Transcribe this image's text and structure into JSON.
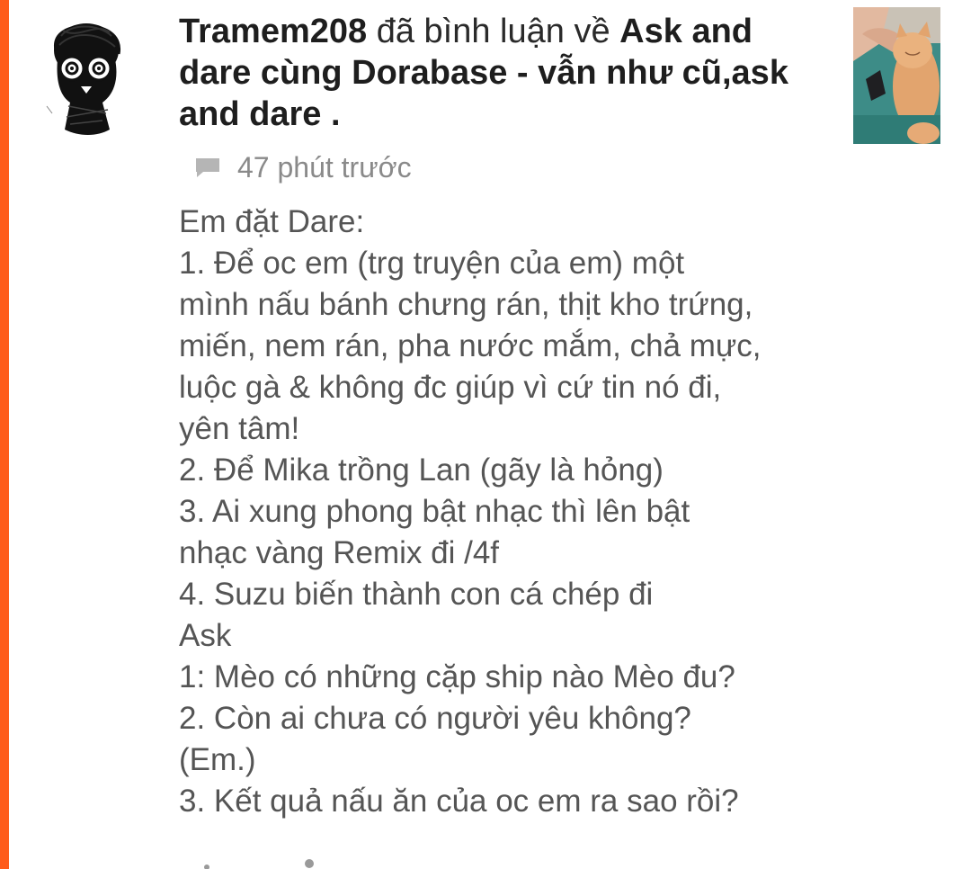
{
  "notification": {
    "username": "Tramem208",
    "verb": "đã bình luận về",
    "post_title_line1": "Ask and",
    "post_title_line2": "dare cùng Dorabase - vẫn như cũ,ask",
    "post_title_line3": "and dare .",
    "time_ago": "47 phút trước",
    "comment_lines": [
      "Em đặt Dare:",
      "1. Để oc em (trg truyện của em) một",
      "mình nấu bánh chưng rán, thịt kho trứng,",
      "miến, nem rán, pha nước mắm, chả mực,",
      "luộc gà & không đc giúp vì cứ tin nó đi,",
      "yên tâm!",
      "2. Để Mika trồng Lan (gãy là hỏng)",
      "3. Ai xung phong bật nhạc thì lên bật",
      "nhạc vàng Remix đi /4f",
      "4. Suzu biến thành con cá chép đi",
      "Ask",
      "1: Mèo có những cặp ship nào Mèo đu?",
      "2. Còn ai chưa có người yêu không?",
      "(Em.)",
      "3. Kết quả nấu ăn của oc em ra sao rồi?"
    ]
  },
  "icons": {
    "avatar": "doodle-face-avatar",
    "comment": "speech-bubble-icon",
    "thumbnail": "cat-photo-thumbnail"
  },
  "colors": {
    "accent": "#ff5b1a",
    "title_text": "#1e1e1e",
    "body_text": "#555555",
    "meta_text": "#8a8a8a"
  }
}
